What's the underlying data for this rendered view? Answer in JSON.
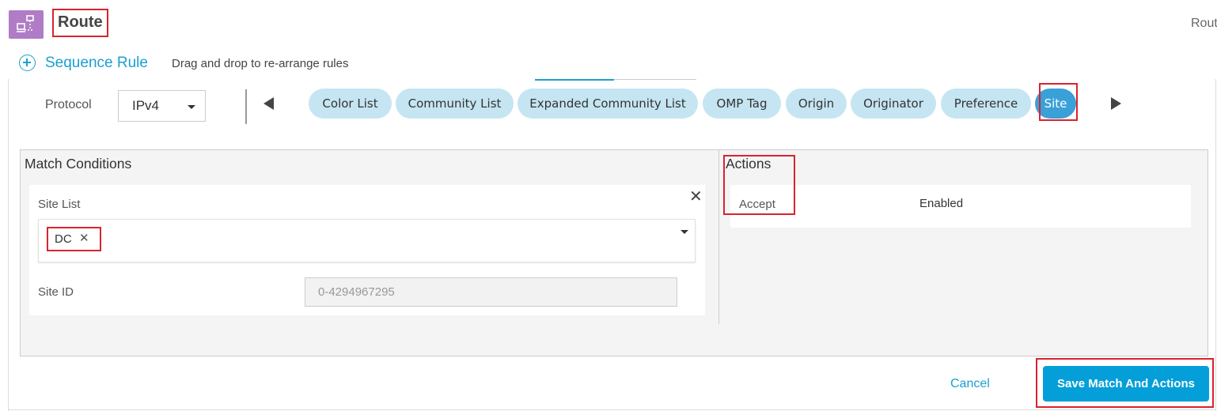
{
  "header": {
    "title": "Route",
    "right_text": "Rout",
    "icon_color": "#b07cc6"
  },
  "sequence": {
    "label": "Sequence Rule",
    "hint": "Drag and drop to re-arrange rules"
  },
  "protocol": {
    "label": "Protocol",
    "value": "IPv4"
  },
  "match_tabs": [
    {
      "label": "Color List",
      "active": false
    },
    {
      "label": "Community List",
      "active": false
    },
    {
      "label": "Expanded Community List",
      "active": false
    },
    {
      "label": "OMP Tag",
      "active": false
    },
    {
      "label": "Origin",
      "active": false
    },
    {
      "label": "Originator",
      "active": false
    },
    {
      "label": "Preference",
      "active": false
    },
    {
      "label": "Site",
      "active": true
    }
  ],
  "match_conditions": {
    "title": "Match Conditions",
    "site_list": {
      "label": "Site List",
      "selected": [
        "DC"
      ]
    },
    "site_id": {
      "label": "Site ID",
      "placeholder": "0-4294967295"
    }
  },
  "actions": {
    "title": "Actions",
    "rows": [
      {
        "name": "Accept",
        "value": "Enabled"
      }
    ]
  },
  "buttons": {
    "cancel": "Cancel",
    "save": "Save Match And Actions"
  },
  "colors": {
    "accent": "#049fd9",
    "pill": "#c5e5f2",
    "pill_active": "#3aa0d8",
    "highlight": "#d9232e"
  }
}
